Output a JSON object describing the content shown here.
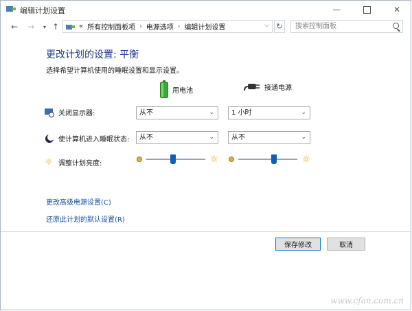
{
  "window": {
    "title": "编辑计划设置"
  },
  "address": {
    "chevrons": "«",
    "crumbs": [
      "所有控制面板项",
      "电源选项",
      "编辑计划设置"
    ],
    "search_placeholder": "搜索控制面板"
  },
  "main": {
    "heading": "更改计划的设置: 平衡",
    "subtext": "选择希望计算机使用的睡眠设置和显示设置。",
    "col_battery": "用电池",
    "col_plugged": "接通电源",
    "rows": {
      "display_label": "关闭显示器:",
      "display_battery": "从不",
      "display_plugged": "1 小时",
      "sleep_label": "使计算机进入睡眠状态:",
      "sleep_battery": "从不",
      "sleep_plugged": "从不",
      "brightness_label": "调整计划亮度:",
      "brightness_battery": 0.45,
      "brightness_plugged": 0.6
    },
    "link_advanced": "更改高级电源设置(C)",
    "link_restore": "还原此计划的默认设置(R)"
  },
  "footer": {
    "save": "保存修改",
    "cancel": "取消"
  },
  "watermark": "www.cfan.com.cn",
  "colors": {
    "heading": "#1e3a8a",
    "link": "#1a4fa0",
    "thumb": "#0f5fb5",
    "battery": "#3aa935"
  }
}
